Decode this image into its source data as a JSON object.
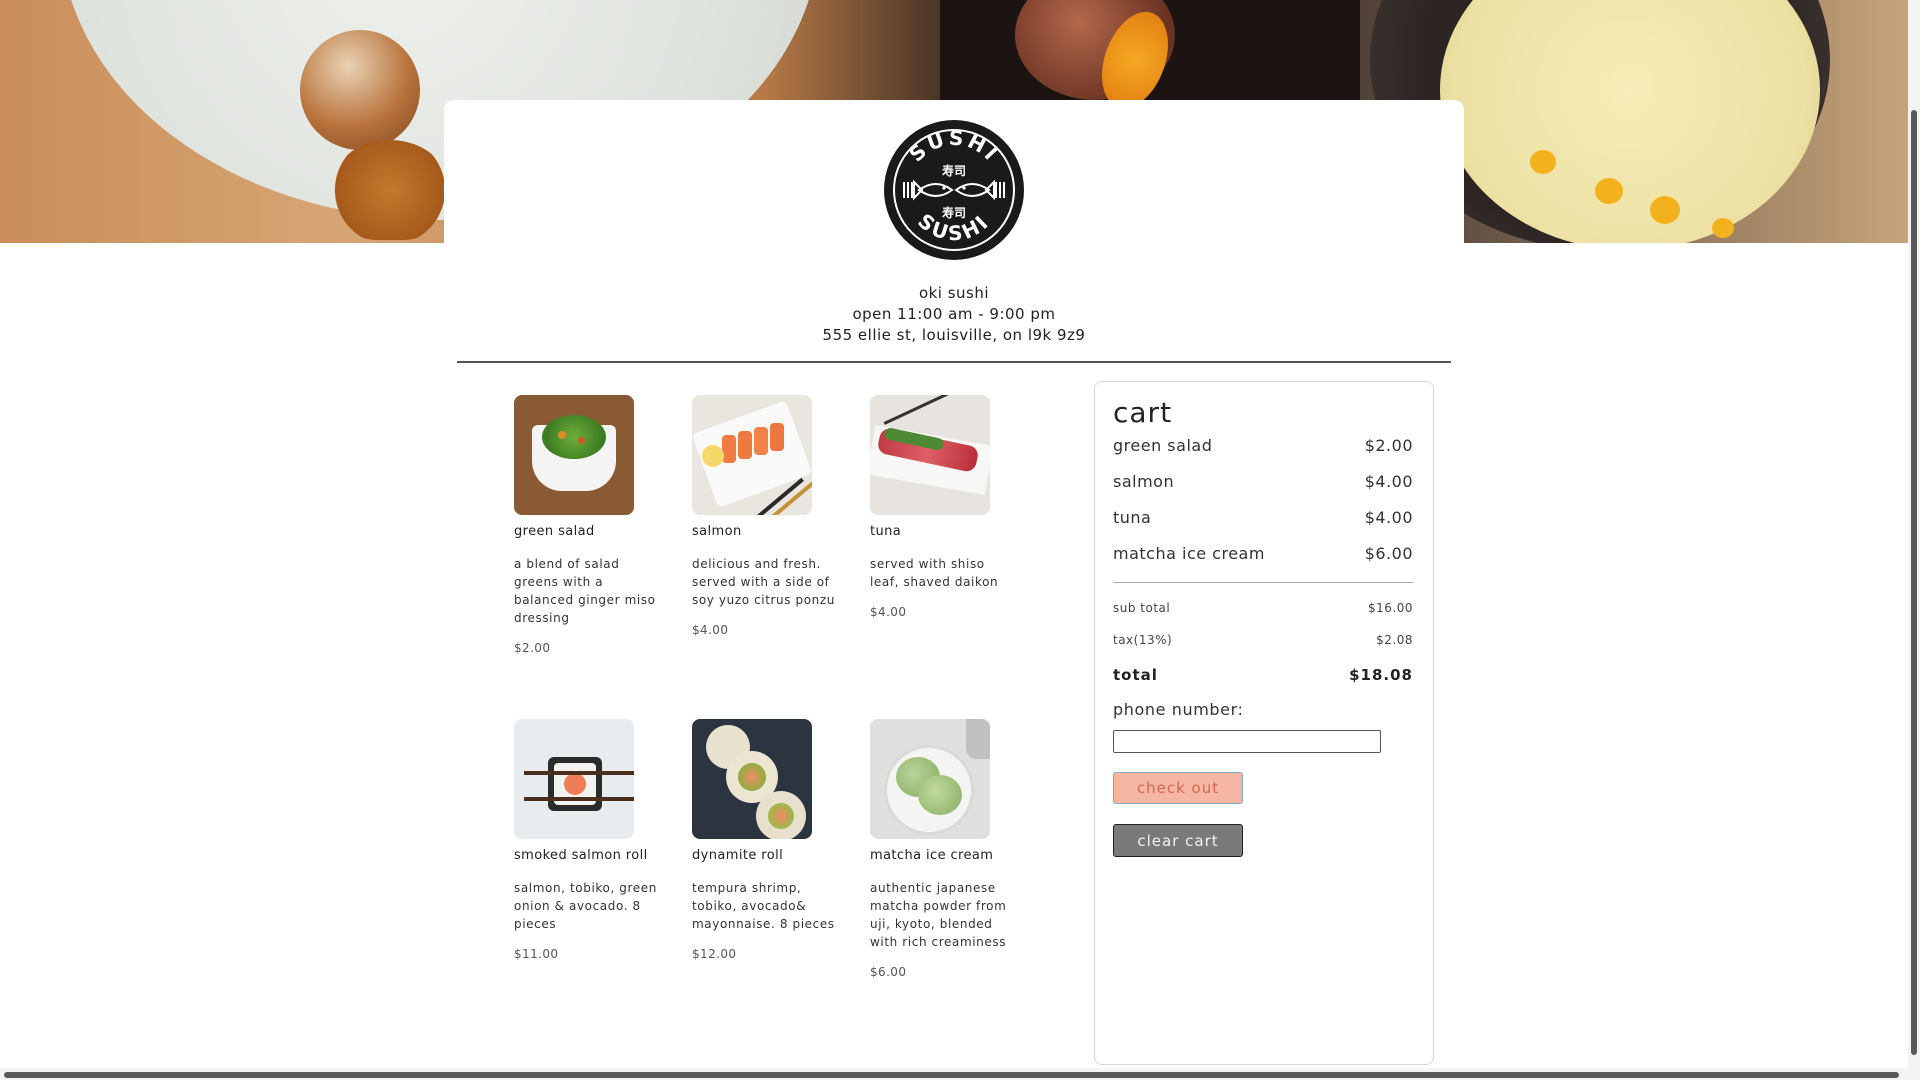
{
  "restaurant": {
    "name": "OKI SUSHI",
    "hours": "Open 11:00 AM - 9:00 PM",
    "address": "555 ELLIE ST, LOUISVILLE, ON L9K 9Z9",
    "logo_text_top": "SUSHI",
    "logo_text_bottom": "SUSHI",
    "logo_kanji": "寿司"
  },
  "menu": [
    {
      "name": "Green Salad",
      "description": "A blend of salad greens with a balanced ginger miso dressing",
      "price": "$2.00"
    },
    {
      "name": "Salmon",
      "description": "Delicious and fresh. Served with a side of soy yuzo citrus Ponzu",
      "price": "$4.00"
    },
    {
      "name": "Tuna",
      "description": "Served with shiso leaf, shaved daikon",
      "price": "$4.00"
    },
    {
      "name": "Smoked Salmon Roll",
      "description": "Salmon, tobiko, green onion & avocado. 8 Pieces",
      "price": "$11.00"
    },
    {
      "name": "Dynamite Roll",
      "description": "Tempura shrimp, tobiko, avocado& mayonnaise. 8 Pieces",
      "price": "$12.00"
    },
    {
      "name": "Matcha Ice Cream",
      "description": "Authentic Japanese matcha powder from Uji, Kyoto, blended with rich creaminess",
      "price": "$6.00"
    }
  ],
  "cart": {
    "title": "Cart",
    "items": [
      {
        "name": "Green Salad",
        "price": "$2.00"
      },
      {
        "name": "Salmon",
        "price": "$4.00"
      },
      {
        "name": "Tuna",
        "price": "$4.00"
      },
      {
        "name": "Matcha Ice Cream",
        "price": "$6.00"
      }
    ],
    "subtotal_label": "SUB TOTAL",
    "subtotal": "$16.00",
    "tax_label": "Tax(13%)",
    "tax": "$2.08",
    "total_label": "TOTAL",
    "total": "$18.08",
    "phone_label": "Phone number:",
    "phone_value": "",
    "checkout_label": "Check out",
    "clear_label": "Clear cart"
  },
  "colors": {
    "checkout_bg": "#f6b6a4",
    "clear_bg": "#7a7a7a"
  }
}
